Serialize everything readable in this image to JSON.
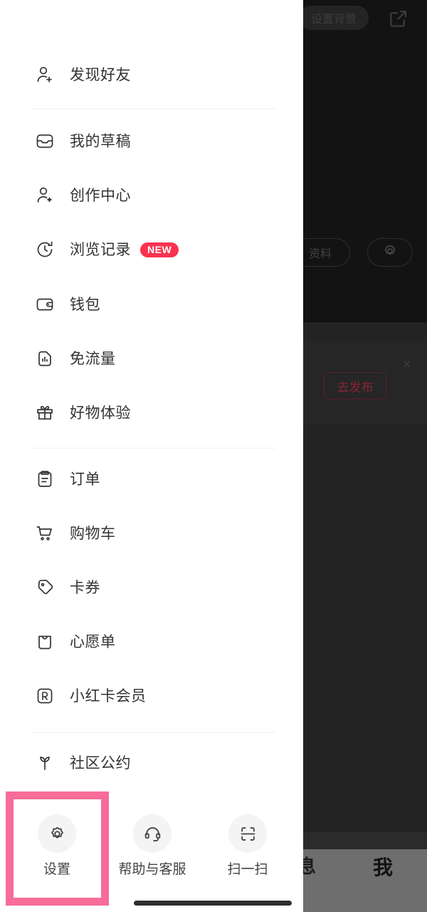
{
  "background": {
    "set_background_pill": "设置背景",
    "share_icon": "external-link-icon",
    "profile_pill": "资料",
    "gear_icon": "gear-icon",
    "publish_button": "去发布",
    "close_icon": "×",
    "nav": {
      "messages": "息",
      "me": "我"
    }
  },
  "drawer": {
    "items": [
      {
        "label": "发现好友",
        "icon": "person-add-icon",
        "badge": ""
      },
      {
        "label": "我的草稿",
        "icon": "inbox-icon",
        "badge": ""
      },
      {
        "label": "创作中心",
        "icon": "person-spark-icon",
        "badge": ""
      },
      {
        "label": "浏览记录",
        "icon": "history-clock-icon",
        "badge": "NEW"
      },
      {
        "label": "钱包",
        "icon": "wallet-icon",
        "badge": ""
      },
      {
        "label": "免流量",
        "icon": "sim-data-icon",
        "badge": ""
      },
      {
        "label": "好物体验",
        "icon": "gift-icon",
        "badge": ""
      },
      {
        "label": "订单",
        "icon": "clipboard-icon",
        "badge": ""
      },
      {
        "label": "购物车",
        "icon": "shopping-cart-icon",
        "badge": ""
      },
      {
        "label": "卡券",
        "icon": "coupon-tag-icon",
        "badge": ""
      },
      {
        "label": "心愿单",
        "icon": "wishlist-bag-icon",
        "badge": ""
      },
      {
        "label": "小红卡会员",
        "icon": "r-card-icon",
        "badge": ""
      },
      {
        "label": "社区公约",
        "icon": "sprout-icon",
        "badge": ""
      }
    ],
    "actions": [
      {
        "label": "设置",
        "icon": "gear-icon"
      },
      {
        "label": "帮助与客服",
        "icon": "headset-icon"
      },
      {
        "label": "扫一扫",
        "icon": "scan-icon"
      }
    ]
  },
  "colors": {
    "badge_new": "#FA3250",
    "highlight": "#F76C98",
    "panel_bg": "#FFFFFF",
    "divider": "#F1F1F1",
    "backdrop": "#141414"
  }
}
